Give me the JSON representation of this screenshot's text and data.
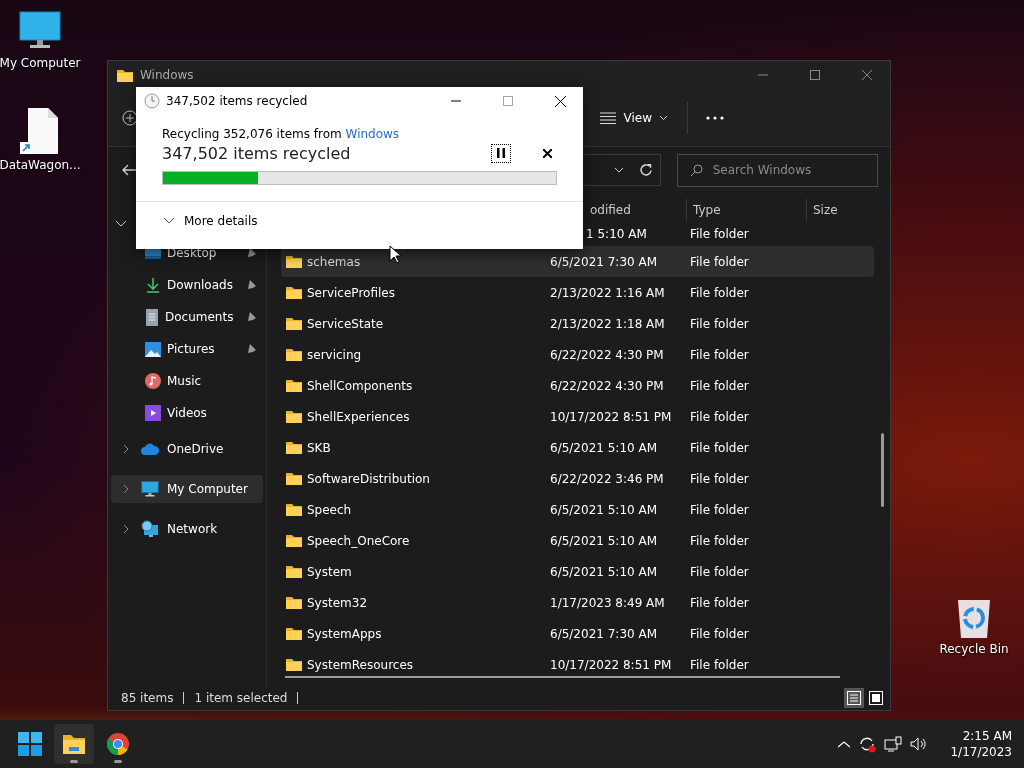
{
  "desktop_icons": [
    {
      "kind": "monitor",
      "label": "My Computer"
    },
    {
      "kind": "shortcut",
      "label": "DataWagon..."
    },
    {
      "kind": "bin",
      "label": "Recycle Bin"
    }
  ],
  "explorer": {
    "title": "Windows",
    "view_label": "View",
    "search": {
      "placeholder": "Search Windows"
    },
    "columns": [
      {
        "label": "odified"
      },
      {
        "label": "Type"
      },
      {
        "label": "Size"
      }
    ],
    "sidebar": {
      "quick_access": {
        "expanded": true,
        "items": [
          {
            "kind": "desktop",
            "label": "Desktop",
            "pinned": true,
            "selected": false
          },
          {
            "kind": "download",
            "label": "Downloads",
            "pinned": true,
            "selected": false
          },
          {
            "kind": "document",
            "label": "Documents",
            "pinned": true,
            "selected": false
          },
          {
            "kind": "pictures",
            "label": "Pictures",
            "pinned": true,
            "selected": false
          },
          {
            "kind": "music",
            "label": "Music",
            "pinned": false,
            "selected": false
          },
          {
            "kind": "videos",
            "label": "Videos",
            "pinned": false,
            "selected": false
          }
        ]
      },
      "tree": [
        {
          "kind": "cloud",
          "label": "OneDrive",
          "expanded": false,
          "selected": false
        },
        {
          "kind": "monitor",
          "label": "My Computer",
          "expanded": false,
          "selected": true
        },
        {
          "kind": "network",
          "label": "Network",
          "expanded": false,
          "selected": false
        }
      ]
    },
    "rows": [
      {
        "kind": "cut",
        "date": "1 5:10 AM",
        "type": "File folder",
        "selected": false
      },
      {
        "kind": "folder",
        "name": "schemas",
        "date": "6/5/2021 7:30 AM",
        "type": "File folder",
        "selected": true
      },
      {
        "kind": "folder",
        "name": "ServiceProfiles",
        "date": "2/13/2022 1:16 AM",
        "type": "File folder",
        "selected": false
      },
      {
        "kind": "folder",
        "name": "ServiceState",
        "date": "2/13/2022 1:18 AM",
        "type": "File folder",
        "selected": false
      },
      {
        "kind": "folder",
        "name": "servicing",
        "date": "6/22/2022 4:30 PM",
        "type": "File folder",
        "selected": false
      },
      {
        "kind": "folder",
        "name": "ShellComponents",
        "date": "6/22/2022 4:30 PM",
        "type": "File folder",
        "selected": false
      },
      {
        "kind": "folder",
        "name": "ShellExperiences",
        "date": "10/17/2022 8:51 PM",
        "type": "File folder",
        "selected": false
      },
      {
        "kind": "folder",
        "name": "SKB",
        "date": "6/5/2021 5:10 AM",
        "type": "File folder",
        "selected": false
      },
      {
        "kind": "folder",
        "name": "SoftwareDistribution",
        "date": "6/22/2022 3:46 PM",
        "type": "File folder",
        "selected": false
      },
      {
        "kind": "folder",
        "name": "Speech",
        "date": "6/5/2021 5:10 AM",
        "type": "File folder",
        "selected": false
      },
      {
        "kind": "folder",
        "name": "Speech_OneCore",
        "date": "6/5/2021 5:10 AM",
        "type": "File folder",
        "selected": false
      },
      {
        "kind": "folder",
        "name": "System",
        "date": "6/5/2021 5:10 AM",
        "type": "File folder",
        "selected": false
      },
      {
        "kind": "folder",
        "name": "System32",
        "date": "1/17/2023 8:49 AM",
        "type": "File folder",
        "selected": false
      },
      {
        "kind": "folder",
        "name": "SystemApps",
        "date": "6/5/2021 7:30 AM",
        "type": "File folder",
        "selected": false
      },
      {
        "kind": "folder",
        "name": "SystemResources",
        "date": "10/17/2022 8:51 PM",
        "type": "File folder",
        "selected": false
      }
    ],
    "status_bar": {
      "count": "85 items",
      "selection": "1 item selected"
    },
    "view_buttons": [
      {
        "kind": "details",
        "selected": true
      },
      {
        "kind": "tiles",
        "selected": false
      }
    ]
  },
  "dialog": {
    "title": "347,502 items recycled",
    "message": "Recycling 352,076 items from ",
    "source_link": "Windows",
    "status": "347,502 items recycled",
    "level": 0.243,
    "maximize_disabled": true,
    "details_label": "More details"
  },
  "taskbar": {
    "apps": [
      {
        "kind": "start",
        "active": false,
        "running": false
      },
      {
        "kind": "explorer",
        "active": true,
        "running": true
      },
      {
        "kind": "chrome",
        "active": false,
        "running": true
      }
    ],
    "time": "2:15 AM",
    "date": "1/17/2023"
  }
}
